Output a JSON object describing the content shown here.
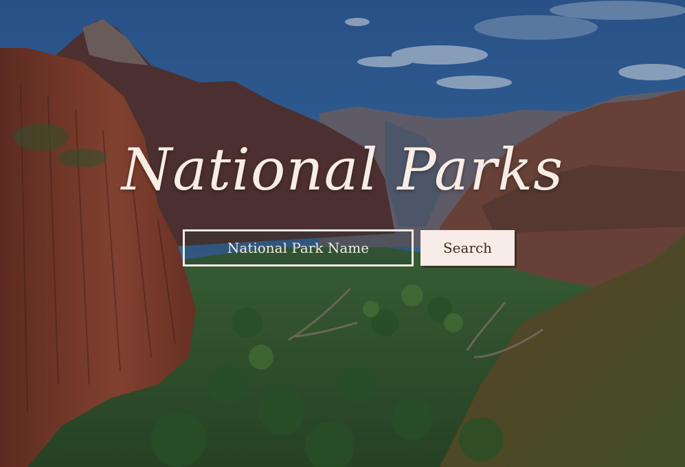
{
  "hero": {
    "title": "National Parks",
    "background": "zion-canyon-photo"
  },
  "search": {
    "placeholder": "National Park Name",
    "value": "",
    "button_label": "Search"
  },
  "colors": {
    "title_text": "#f8ece4",
    "input_border": "#f4ebe4",
    "button_bg": "#f7ede6",
    "button_text": "#3a2a22"
  }
}
